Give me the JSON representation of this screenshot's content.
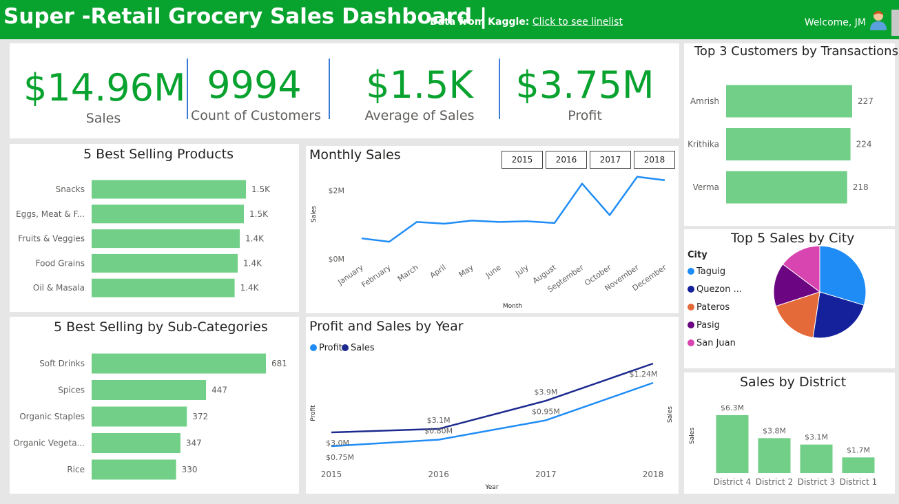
{
  "header": {
    "title": "Super -Retail Grocery Sales Dashboard |",
    "source_label": "Data from Kaggle:",
    "source_link": "Click to see linelist",
    "welcome": "Welcome, JM",
    "bg_color": "#08a22e"
  },
  "kpis": [
    {
      "value": "$14.96M",
      "label": "Sales"
    },
    {
      "value": "9994",
      "label": "Count of Customers"
    },
    {
      "value": "$1.5K",
      "label": "Average of Sales"
    },
    {
      "value": "$3.75M",
      "label": "Profit"
    }
  ],
  "chart_data": [
    {
      "id": "best_products",
      "type": "bar",
      "orientation": "horizontal",
      "title": "5 Best Selling Products",
      "categories": [
        "Snacks",
        "Eggs, Meat & F...",
        "Fruits & Veggies",
        "Food Grains",
        "Oil & Masala"
      ],
      "values": [
        1.5,
        1.48,
        1.44,
        1.42,
        1.39
      ],
      "labels": [
        "1.5K",
        "1.5K",
        "1.4K",
        "1.4K",
        "1.4K"
      ],
      "color": "#72cf87"
    },
    {
      "id": "best_subcats",
      "type": "bar",
      "orientation": "horizontal",
      "title": "5 Best Selling by Sub-Categories",
      "categories": [
        "Soft Drinks",
        "Spices",
        "Organic Staples",
        "Organic Vegeta...",
        "Rice"
      ],
      "values": [
        681,
        447,
        372,
        347,
        330
      ],
      "labels": [
        "681",
        "447",
        "372",
        "347",
        "330"
      ],
      "color": "#72cf87"
    },
    {
      "id": "monthly_sales",
      "type": "line",
      "title": "Monthly Sales",
      "xlabel": "Month",
      "ylabel": "Sales",
      "x": [
        "January",
        "February",
        "March",
        "April",
        "May",
        "June",
        "July",
        "August",
        "September",
        "October",
        "November",
        "December"
      ],
      "values": [
        0.6,
        0.5,
        1.08,
        1.03,
        1.12,
        1.08,
        1.1,
        1.05,
        2.2,
        1.28,
        2.4,
        2.3
      ],
      "yticks": [
        {
          "v": 0,
          "label": "$0M"
        },
        {
          "v": 2,
          "label": "$2M"
        }
      ],
      "ylim": [
        0,
        3.1
      ],
      "color": "#1f8cf5",
      "slicer": [
        "2015",
        "2016",
        "2017",
        "2018"
      ]
    },
    {
      "id": "profit_sales_year",
      "type": "line",
      "title": "Profit and Sales by Year",
      "xlabel": "Year",
      "ylabel": "Profit",
      "ylabel2": "Sales",
      "x": [
        "2015",
        "2016",
        "2017",
        "2018"
      ],
      "series": [
        {
          "name": "Profit",
          "values": [
            0.75,
            0.8,
            0.95,
            1.24
          ],
          "labels": [
            "$0.75M",
            "$0.80M",
            "$0.95M",
            "$1.24M"
          ],
          "color": "#1f8cf5"
        },
        {
          "name": "Sales",
          "values": [
            3.0,
            3.1,
            3.9,
            4.96
          ],
          "labels": [
            "$3.0M",
            "$3.1M",
            "$3.9M",
            ""
          ],
          "color": "#1c2a8f"
        }
      ],
      "legend": "top-left"
    },
    {
      "id": "top_customers",
      "type": "bar",
      "orientation": "horizontal",
      "title": "Top 3 Customers by Transactions",
      "categories": [
        "Amrish",
        "Krithika",
        "Verma"
      ],
      "values": [
        227,
        224,
        218
      ],
      "labels": [
        "227",
        "224",
        "218"
      ],
      "color": "#72cf87"
    },
    {
      "id": "top_cities",
      "type": "pie",
      "title": "Top 5 Sales by City",
      "legend_title": "City",
      "categories": [
        "Taguig",
        "Quezon ...",
        "Pateros",
        "Pasig",
        "San Juan"
      ],
      "values": [
        0.2965,
        0.2272,
        0.1765,
        0.1524,
        0.1474
      ],
      "colors": [
        "#1f8cf5",
        "#15219b",
        "#e56a3a",
        "#6b0582",
        "#d845b0"
      ],
      "legend": "left"
    },
    {
      "id": "sales_district",
      "type": "bar",
      "orientation": "vertical",
      "title": "Sales by District",
      "ylabel": "Sales",
      "categories": [
        "District 4",
        "District 2",
        "District 3",
        "District 1"
      ],
      "values": [
        6.3,
        3.8,
        3.1,
        1.7
      ],
      "labels": [
        "$6.3M",
        "$3.8M",
        "$3.1M",
        "$1.7M"
      ],
      "color": "#72cf87"
    }
  ]
}
